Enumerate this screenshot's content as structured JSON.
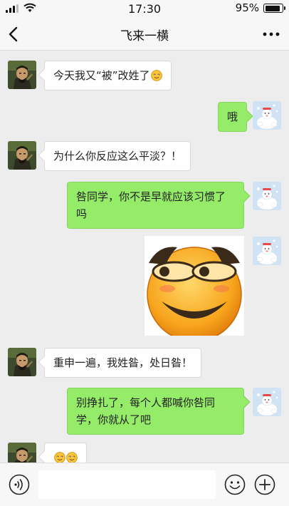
{
  "status_bar": {
    "time": "17:30",
    "battery_percent": "95%",
    "battery_level": 0.95
  },
  "header": {
    "title": "飞来一横",
    "back_icon": "chevron-left-icon",
    "more_icon": "more-dots-icon"
  },
  "messages": [
    {
      "side": "in",
      "text": "今天我又“被”改姓了",
      "emoji": [
        "smirk-emoji"
      ]
    },
    {
      "side": "out",
      "text": "哦"
    },
    {
      "side": "in",
      "text": "为什么你反应这么平淡？！"
    },
    {
      "side": "out",
      "text": "咎同学，你不是早就应该习惯了吗"
    },
    {
      "side": "out",
      "type": "sticker",
      "sticker": "smug-face-sticker"
    },
    {
      "side": "in",
      "text": "重申一遍，我姓昝，处日昝！"
    },
    {
      "side": "out",
      "text": "别挣扎了，每个人都喊你咎同学，你就从了吧"
    },
    {
      "side": "in",
      "text": "",
      "emoji": [
        "smirk-emoji",
        "smirk-emoji"
      ]
    }
  ],
  "input_bar": {
    "voice_icon": "voice-icon",
    "emoji_icon": "emoji-icon",
    "add_icon": "plus-circle-icon",
    "placeholder": ""
  },
  "colors": {
    "outgoing_bubble": "#95ec69",
    "incoming_bubble": "#ffffff",
    "background": "#ededed"
  }
}
